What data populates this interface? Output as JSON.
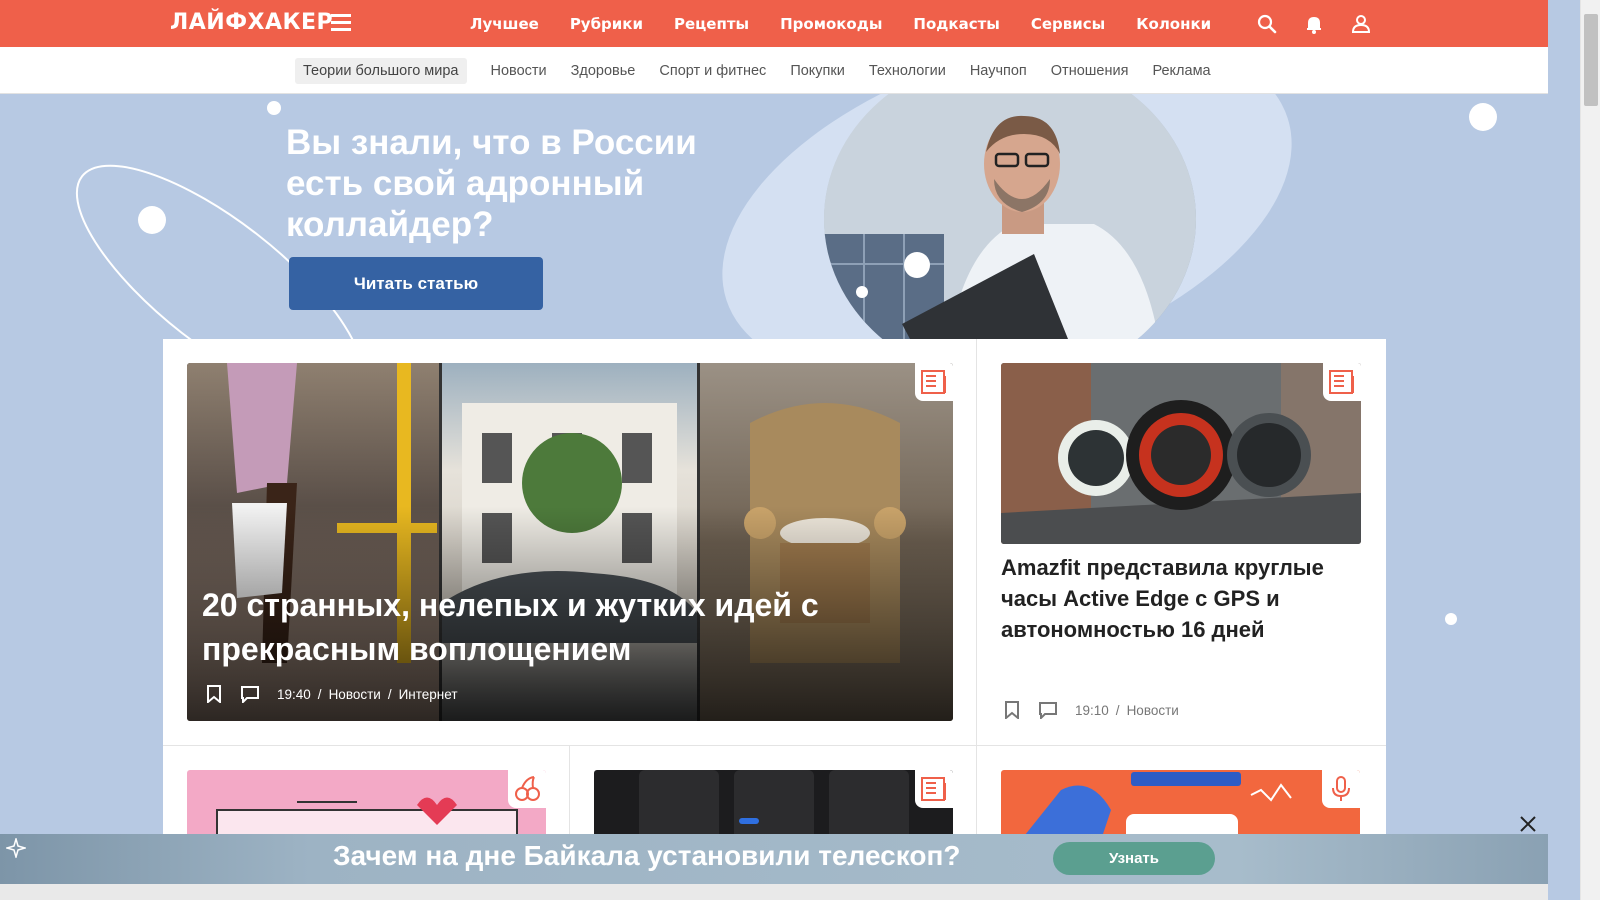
{
  "header": {
    "logo": "ЛАЙФХАКЕР",
    "nav": [
      "Лучшее",
      "Рубрики",
      "Рецепты",
      "Промокоды",
      "Подкасты",
      "Сервисы",
      "Колонки"
    ],
    "icons": [
      "search-icon",
      "bell-icon",
      "user-icon"
    ]
  },
  "subnav": {
    "items": [
      "Теории большого мира",
      "Новости",
      "Здоровье",
      "Спорт и фитнес",
      "Покупки",
      "Технологии",
      "Научпоп",
      "Отношения",
      "Реклама"
    ]
  },
  "hero": {
    "title": "Вы знали, что в России есть свой адронный коллайдер?",
    "button": "Читать статью"
  },
  "articles": {
    "main": {
      "title": "20 странных, нелепых и жутких идей с прекрасным воплощением",
      "time": "19:40",
      "category": "Новости",
      "subcategory": "Интернет"
    },
    "side": {
      "title": "Amazfit представила круглые часы Active Edge с GPS и автономностью 16 дней",
      "time": "19:10",
      "category": "Новости"
    }
  },
  "ad": {
    "text": "Зачем на дне Байкала установили телескоп?",
    "button": "Узнать"
  },
  "colors": {
    "brand": "#ef604a",
    "hero_bg": "#b7c9e3",
    "button": "#3562a3"
  }
}
